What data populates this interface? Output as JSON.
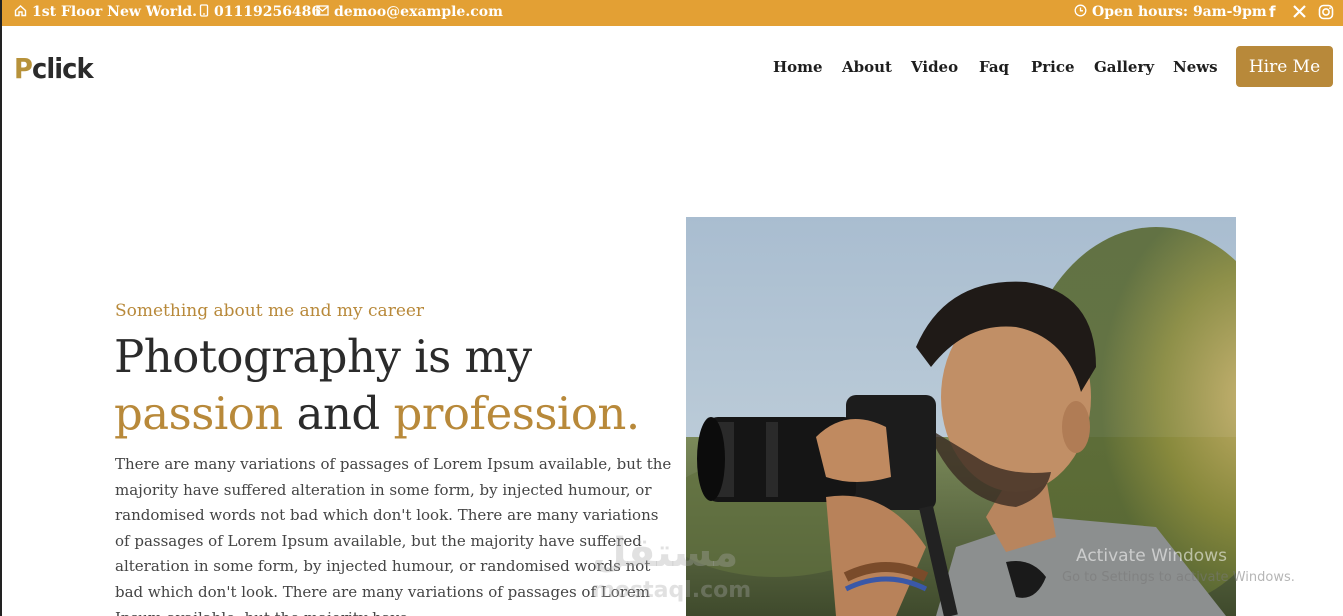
{
  "topbar": {
    "address": "1st Floor New World.",
    "phone": "01119256486",
    "email": "demoo@example.com",
    "hours": "Open hours: 9am-9pm",
    "icons": {
      "address": "home-icon",
      "phone": "phone-icon",
      "email": "mail-icon",
      "hours": "clock-icon"
    },
    "social": [
      "facebook-icon",
      "x-icon",
      "instagram-icon"
    ],
    "color": "#e3a034"
  },
  "logo": {
    "first": "P",
    "rest": "click"
  },
  "nav": [
    "Home",
    "About",
    "Video",
    "Faq",
    "Price",
    "Gallery",
    "News"
  ],
  "cta": "Hire Me",
  "hero": {
    "eyebrow": "Something about me and my career",
    "headline_line1": "Photography is my",
    "headline_gold1": "passion",
    "headline_and": "and",
    "headline_gold2": "profession.",
    "paragraph": "There are many variations of passages of Lorem Ipsum available, but the majority have suffered alteration in some form, by injected humour, or randomised words not bad which don't look. There are many variations of passages of Lorem Ipsum available, but the majority have suffered alteration in some form, by injected humour, or randomised words not bad which don't look. There are many variations of passages of Lorem Ipsum available, but the majority have"
  },
  "watermark": {
    "activate_title": "Activate Windows",
    "activate_sub": "Go to Settings to activate Windows.",
    "mostaql": "مستقل",
    "mostaql_latin": "mostaql.com"
  },
  "accent": "#b8893a"
}
